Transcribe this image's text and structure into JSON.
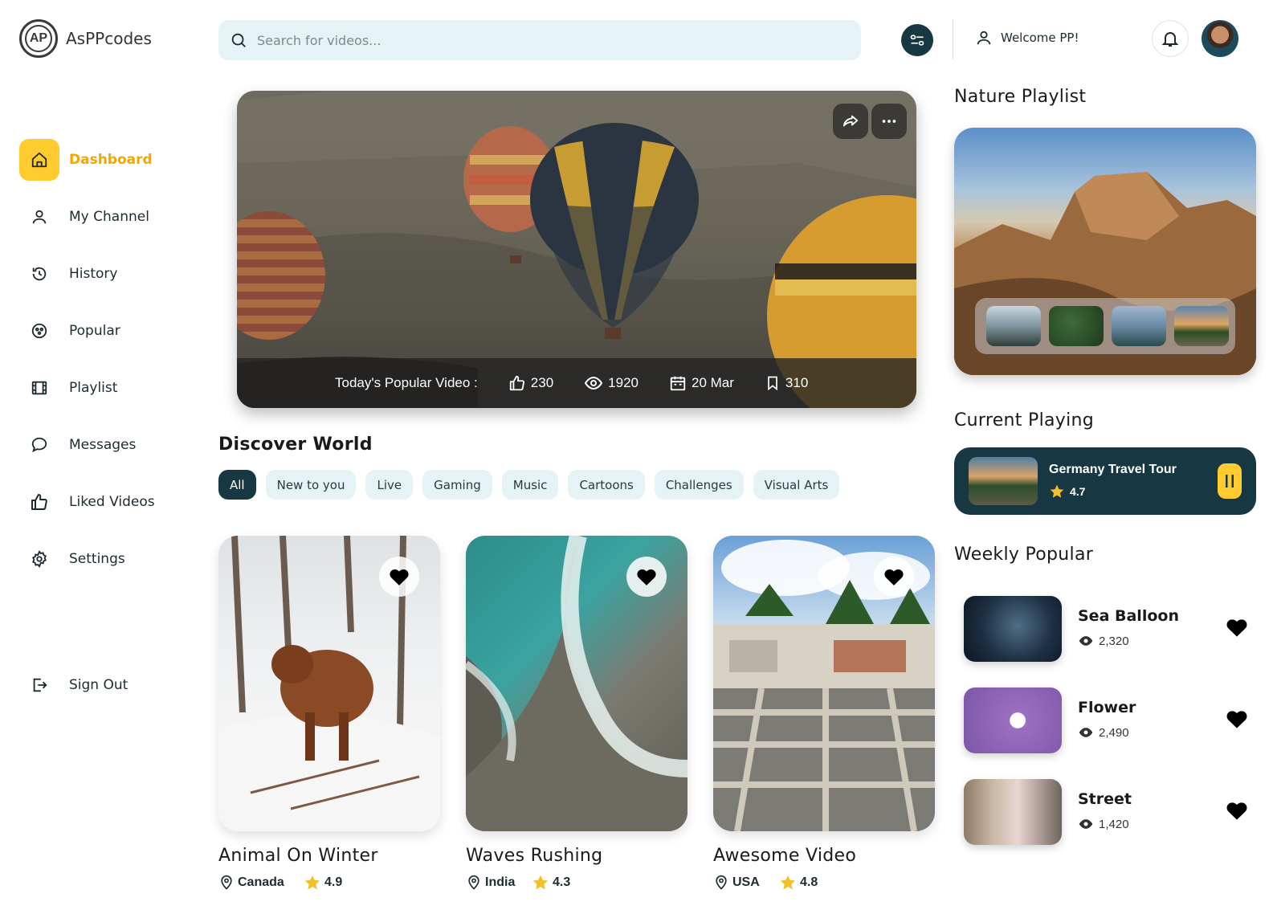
{
  "app": {
    "logo_mark": "AP",
    "name": "AsPPcodes"
  },
  "sidebar": {
    "items": [
      {
        "label": "Dashboard",
        "icon": "home-icon",
        "active": true
      },
      {
        "label": "My Channel",
        "icon": "user-icon"
      },
      {
        "label": "History",
        "icon": "history-icon"
      },
      {
        "label": "Popular",
        "icon": "popular-icon"
      },
      {
        "label": "Playlist",
        "icon": "film-icon"
      },
      {
        "label": "Messages",
        "icon": "message-icon"
      },
      {
        "label": "Liked Videos",
        "icon": "thumbs-up-icon"
      },
      {
        "label": "Settings",
        "icon": "gear-icon"
      }
    ],
    "signout": "Sign Out"
  },
  "header": {
    "search_placeholder": "Search for videos...",
    "welcome": "Welcome PP!"
  },
  "hero": {
    "label": "Today's Popular Video :",
    "likes": "230",
    "views": "1920",
    "date": "20 Mar",
    "saves": "310"
  },
  "discover": {
    "title": "Discover World",
    "chips": [
      "All",
      "New to you",
      "Live",
      "Gaming",
      "Music",
      "Cartoons",
      "Challenges",
      "Visual Arts"
    ],
    "active_chip": "All",
    "cards": [
      {
        "title": "Animal On Winter",
        "location": "Canada",
        "rating": "4.9"
      },
      {
        "title": "Waves Rushing",
        "location": "India",
        "rating": "4.3"
      },
      {
        "title": "Awesome Video",
        "location": "USA",
        "rating": "4.8"
      }
    ]
  },
  "right": {
    "playlist_title": "Nature Playlist",
    "current_title": "Current Playing",
    "current": {
      "title": "Germany Travel Tour",
      "rating": "4.7"
    },
    "weekly_title": "Weekly Popular",
    "weekly": [
      {
        "title": "Sea Balloon",
        "views": "2,320"
      },
      {
        "title": "Flower",
        "views": "2,490"
      },
      {
        "title": "Street",
        "views": "1,420"
      }
    ]
  },
  "colors": {
    "accent": "#ffcb2f",
    "dark": "#173843",
    "chip_bg": "#e5f3f6"
  }
}
